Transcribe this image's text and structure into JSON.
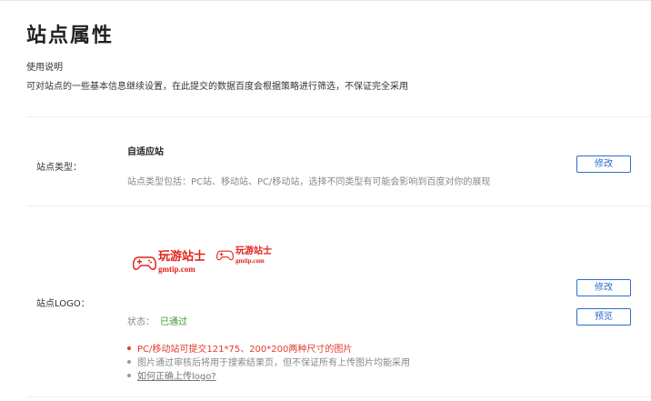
{
  "page": {
    "title": "站点属性",
    "usage_title": "使用说明",
    "usage_desc": "可对站点的一些基本信息继续设置，在此提交的数据百度会根据策略进行筛选，不保证完全采用"
  },
  "site_type": {
    "label": "站点类型：",
    "value": "自适应站",
    "hint": "站点类型包括：PC站、移动站、PC/移动站，选择不同类型有可能会影响到百度对你的展现",
    "modify_label": "修改"
  },
  "site_logo": {
    "label": "站点LOGO：",
    "logo_large": {
      "cn_text": "玩游站士",
      "url_text": "gmtip.com"
    },
    "logo_small": {
      "cn_text": "玩游站士",
      "url_text": "gmtip.com"
    },
    "status_label": "状态：",
    "status_value": "已通过",
    "status_color": "#3c9a2f",
    "modify_label": "修改",
    "preview_label": "预览",
    "notes": [
      {
        "text": "PC/移动站可提交121*75、200*200两种尺寸的图片",
        "color": "#e33b2e"
      },
      {
        "text": "图片通过审核后将用于搜索结果页，但不保证所有上传图片均能采用",
        "color": "#888888"
      },
      {
        "text": "如何正确上传logo?",
        "color": "#777777",
        "link": true
      }
    ]
  },
  "colors": {
    "accent": "#2d6ec9",
    "logo_red": "#e2231a"
  }
}
